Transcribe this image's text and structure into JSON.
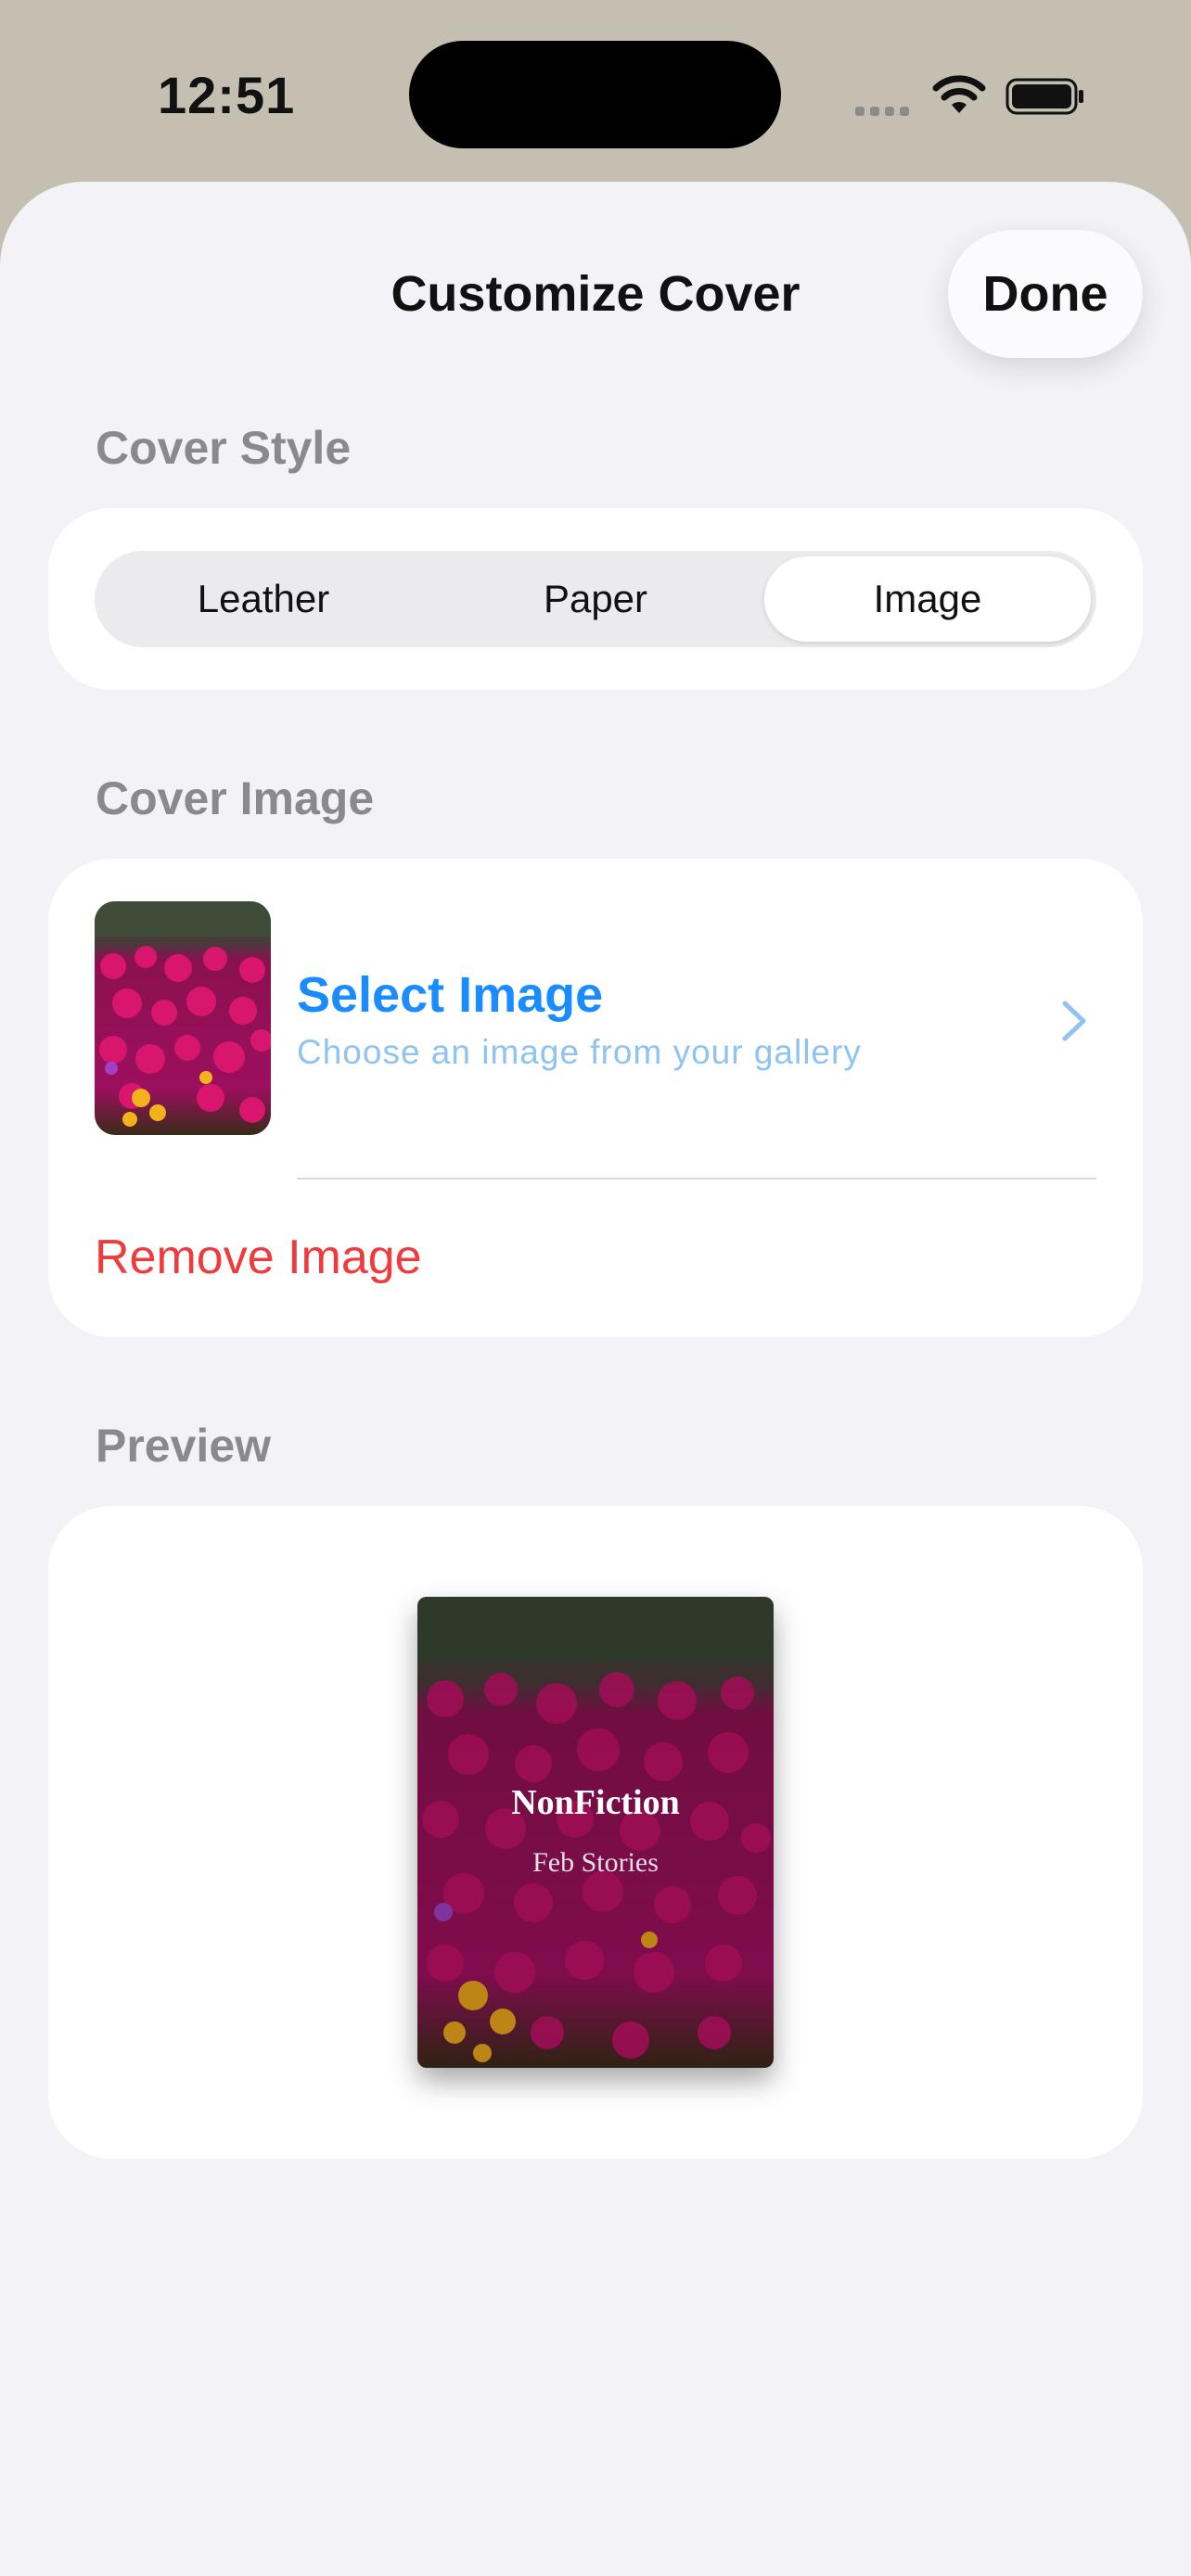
{
  "status_bar": {
    "time": "12:51",
    "icons": [
      "cellular-signal-icon",
      "wifi-icon",
      "battery-icon"
    ]
  },
  "header": {
    "title": "Customize Cover",
    "done_label": "Done"
  },
  "cover_style": {
    "section_label": "Cover Style",
    "options": [
      "Leather",
      "Paper",
      "Image"
    ],
    "selected": "Image"
  },
  "cover_image": {
    "section_label": "Cover Image",
    "select_title": "Select Image",
    "select_subtitle": "Choose an image from your gallery",
    "remove_label": "Remove Image"
  },
  "preview": {
    "section_label": "Preview",
    "book_title": "NonFiction",
    "book_subtitle": "Feb Stories"
  },
  "colors": {
    "accent": "#1a8cff",
    "destructive": "#ef3b3b",
    "sheet_background": "#f2f2f7",
    "secondary_label": "#8a8a8e"
  }
}
